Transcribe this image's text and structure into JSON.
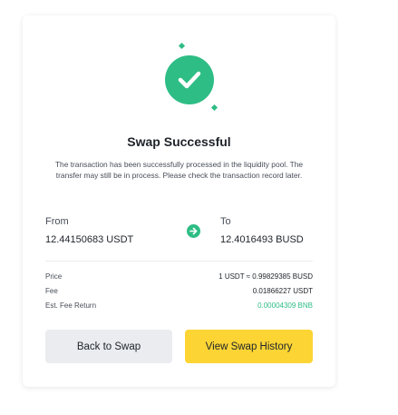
{
  "result": {
    "title": "Swap Successful",
    "description": "The transaction has been successfully processed in the liquidity pool. The transfer may still be in process. Please check the transaction record later."
  },
  "swap": {
    "from_label": "From",
    "from_value": "12.44150683 USDT",
    "to_label": "To",
    "to_value": "12.4016493 BUSD"
  },
  "details": {
    "price_label": "Price",
    "price_value": "1 USDT ≈ 0.99829385 BUSD",
    "fee_label": "Fee",
    "fee_value": "0.01866227 USDT",
    "fee_return_label": "Est. Fee Return",
    "fee_return_value": "0.00004309 BNB"
  },
  "buttons": {
    "back_label": "Back to Swap",
    "history_label": "View Swap History"
  },
  "icons": {
    "success": "check-circle-icon",
    "swap_direction": "arrow-right-icon"
  },
  "colors": {
    "success_green": "#2ebd85",
    "primary_yellow": "#fcd535",
    "secondary_gray": "#eaecef"
  }
}
